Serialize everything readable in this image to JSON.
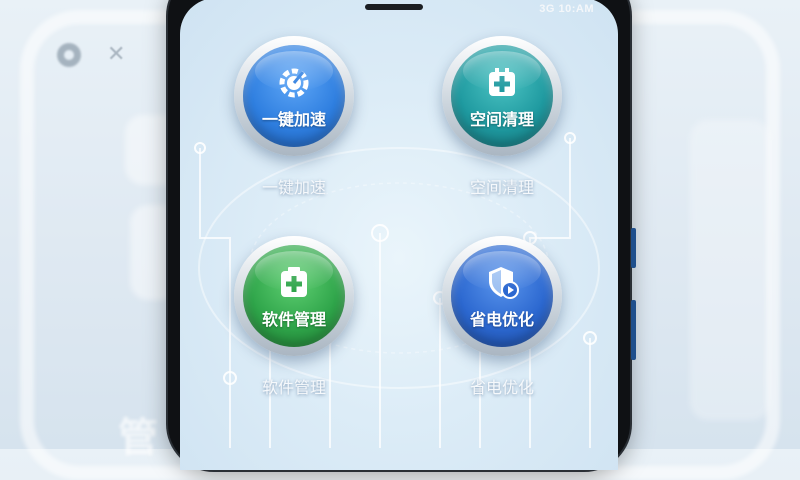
{
  "status_bar": {
    "text": "3G 10:AM"
  },
  "apps": [
    {
      "button_label": "一键加速",
      "caption": "一键加速",
      "icon": "speedometer-gear-icon",
      "color": "#2f7fe0"
    },
    {
      "button_label": "空间清理",
      "caption": "空间清理",
      "icon": "battery-plus-icon",
      "color": "#1f9aa0"
    },
    {
      "button_label": "软件管理",
      "caption": "软件管理",
      "icon": "battery-plus-icon",
      "color": "#2fa54a"
    },
    {
      "button_label": "省电优化",
      "caption": "省电优化",
      "icon": "shield-play-icon",
      "color": "#2c68d0"
    }
  ],
  "background": {
    "text": "管"
  }
}
